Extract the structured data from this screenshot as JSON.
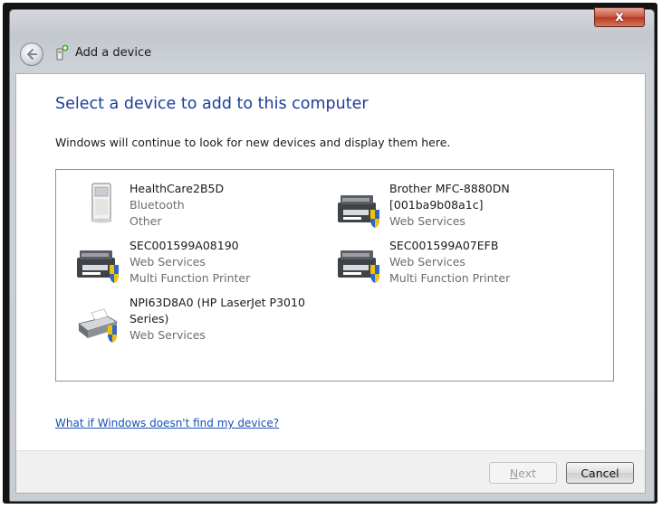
{
  "window": {
    "title": "Add a device",
    "close_label": "x",
    "back_icon": "back-arrow-icon",
    "title_icon": "add-device-icon"
  },
  "main": {
    "heading": "Select a device to add to this computer",
    "instruction": "Windows will continue to look for new devices and display them here."
  },
  "devices": [
    {
      "name": "HealthCare2B5D",
      "lines": [
        "Bluetooth",
        "Other"
      ],
      "icon": "generic-device-icon"
    },
    {
      "name": "Brother MFC-8880DN",
      "lines": [
        "[001ba9b08a1c]",
        "Web Services"
      ],
      "name_line2_dark": true,
      "icon": "multifunction-printer-icon"
    },
    {
      "name": "SEC001599A08190",
      "lines": [
        "Web Services",
        "Multi Function Printer"
      ],
      "icon": "multifunction-printer-icon"
    },
    {
      "name": "SEC001599A07EFB",
      "lines": [
        "Web Services",
        "Multi Function Printer"
      ],
      "icon": "multifunction-printer-icon"
    },
    {
      "name": "NPI63D8A0 (HP LaserJet P3010",
      "lines": [
        "Series)",
        "Web Services"
      ],
      "name_line2_dark": true,
      "icon": "laser-printer-icon"
    }
  ],
  "help_link": "What if Windows doesn't find my device?",
  "buttons": {
    "next_label_underlined": "N",
    "next_label_rest": "ext",
    "cancel_label": "Cancel"
  },
  "colors": {
    "heading": "#1c3d9a",
    "link": "#1651b7",
    "close_button": "#c7533b"
  }
}
